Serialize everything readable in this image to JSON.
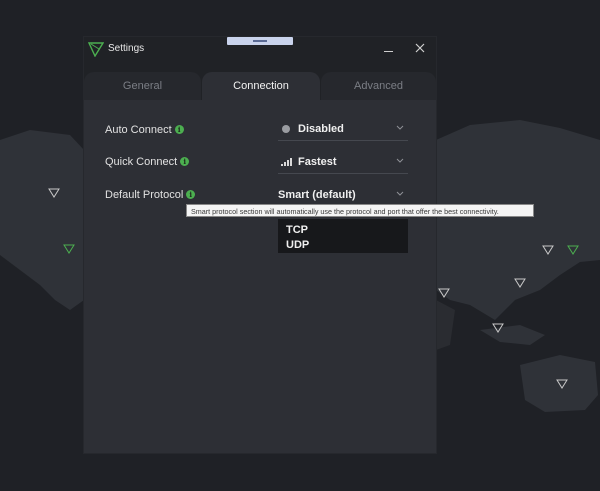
{
  "window": {
    "title": "Settings",
    "logo_icon": "protonvpn-triangle-logo",
    "minimize_icon": "minimize-icon",
    "close_icon": "close-icon"
  },
  "tabs": [
    {
      "label": "General",
      "active": false
    },
    {
      "label": "Connection",
      "active": true
    },
    {
      "label": "Advanced",
      "active": false
    }
  ],
  "settings": {
    "auto_connect": {
      "label": "Auto Connect",
      "value": "Disabled",
      "icon": "status-dot-icon"
    },
    "quick_connect": {
      "label": "Quick Connect",
      "value": "Fastest",
      "icon": "signal-bars-icon"
    },
    "default_protocol": {
      "label": "Default Protocol",
      "value": "Smart (default)",
      "options": [
        "TCP",
        "UDP"
      ]
    }
  },
  "tooltip": "Smart protocol section will automatically use the protocol and port that offer the best connectivity.",
  "colors": {
    "accent_green": "#4caf50",
    "window_bg": "#2d2f35",
    "titlebar_bg": "#202226",
    "map_bg": "#1f2126",
    "land": "#2f3238",
    "marker": "#c8c8c8",
    "marker_active": "#4caf50"
  }
}
